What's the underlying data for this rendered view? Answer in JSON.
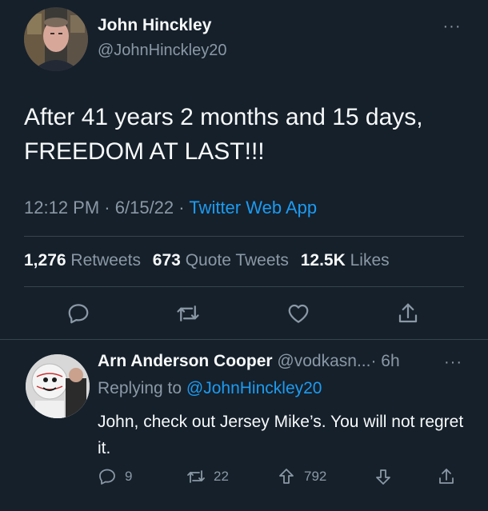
{
  "tweet": {
    "author_name": "John Hinckley",
    "author_handle": "@JohnHinckley20",
    "text": "After 41 years 2 months and 15 days, FREEDOM AT LAST!!!",
    "time": "12:12 PM",
    "date": "6/15/22",
    "separator": "·",
    "source": "Twitter Web App",
    "more_icon": "···",
    "stats": {
      "retweets_count": "1,276",
      "retweets_label": "Retweets",
      "quote_count": "673",
      "quote_label": "Quote Tweets",
      "likes_count": "12.5K",
      "likes_label": "Likes"
    },
    "actions": [
      "reply-icon",
      "retweet-icon",
      "like-icon",
      "share-icon"
    ]
  },
  "reply": {
    "author_name": "Arn Anderson Cooper",
    "author_handle": "@vodkasn...",
    "separator": "·",
    "time": "6h",
    "more_icon": "···",
    "replying_to_label": "Replying to",
    "replying_to_handle": "@JohnHinckley20",
    "text": "John, check out Jersey Mike’s. You will not regret it.",
    "reply_count": "9",
    "retweet_count": "22",
    "upvote_count": "792"
  },
  "colors": {
    "background": "#15202b",
    "text_primary": "#f7f9f9",
    "text_secondary": "#8b98a5",
    "accent": "#1d9bf0",
    "divider": "#38444d"
  }
}
